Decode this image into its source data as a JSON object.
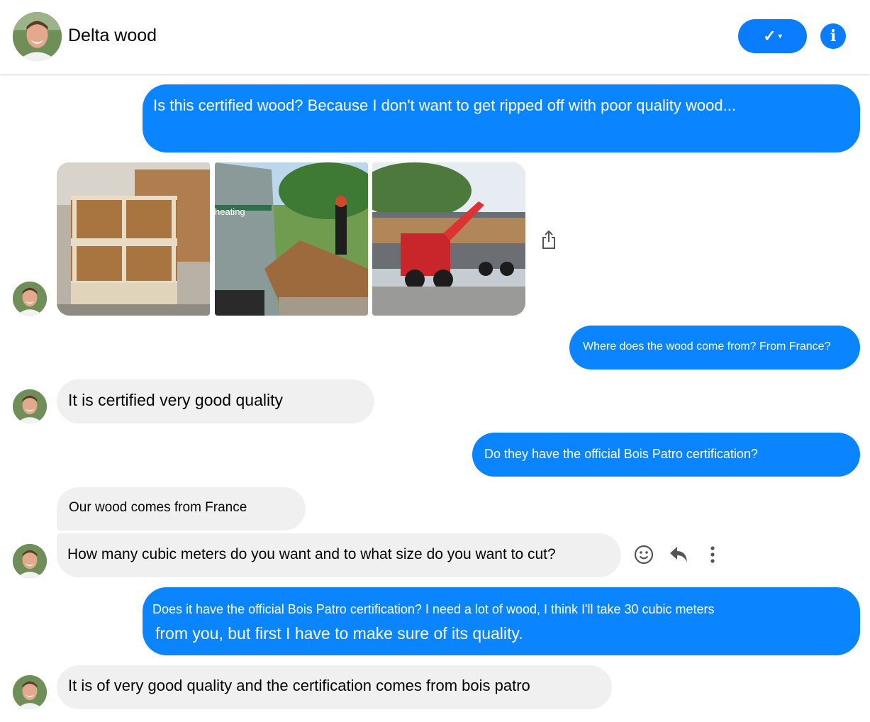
{
  "header": {
    "contact_name": "Delta wood",
    "check_label": "✓",
    "check_caret": "▾",
    "info_label": "i",
    "accent_color": "#0a7cff"
  },
  "photos": {
    "photo2_text": "heating"
  },
  "messages": [
    {
      "side": "outgoing",
      "text": "Is this certified wood? Because I don't want to get ripped off with poor quality wood..."
    },
    {
      "side": "incoming",
      "type": "photo-album",
      "count": 3
    },
    {
      "side": "outgoing",
      "text": "Where does the wood come from? From France?"
    },
    {
      "side": "incoming",
      "text": "It is certified very good quality"
    },
    {
      "side": "outgoing",
      "text": "Do they have the official Bois Patro certification?"
    },
    {
      "side": "incoming",
      "text": "Our wood comes from France"
    },
    {
      "side": "incoming",
      "text": "How many cubic meters do you want and to what size do you want to cut?"
    },
    {
      "side": "outgoing",
      "text_line1": "Does it have the official Bois Patro certification? I need a lot of wood, I think I'll take 30 cubic meters",
      "text_line2": "from you, but first I have to make sure of its quality."
    },
    {
      "side": "incoming",
      "text": "It is of very good quality and the certification comes from bois patro"
    }
  ],
  "icons": {
    "share": "share-icon",
    "emoji": "emoji-icon",
    "reply": "reply-icon",
    "more": "more-icon"
  },
  "colors": {
    "outgoing_bubble": "#0a84ff",
    "incoming_bubble": "#f0f0f0"
  }
}
